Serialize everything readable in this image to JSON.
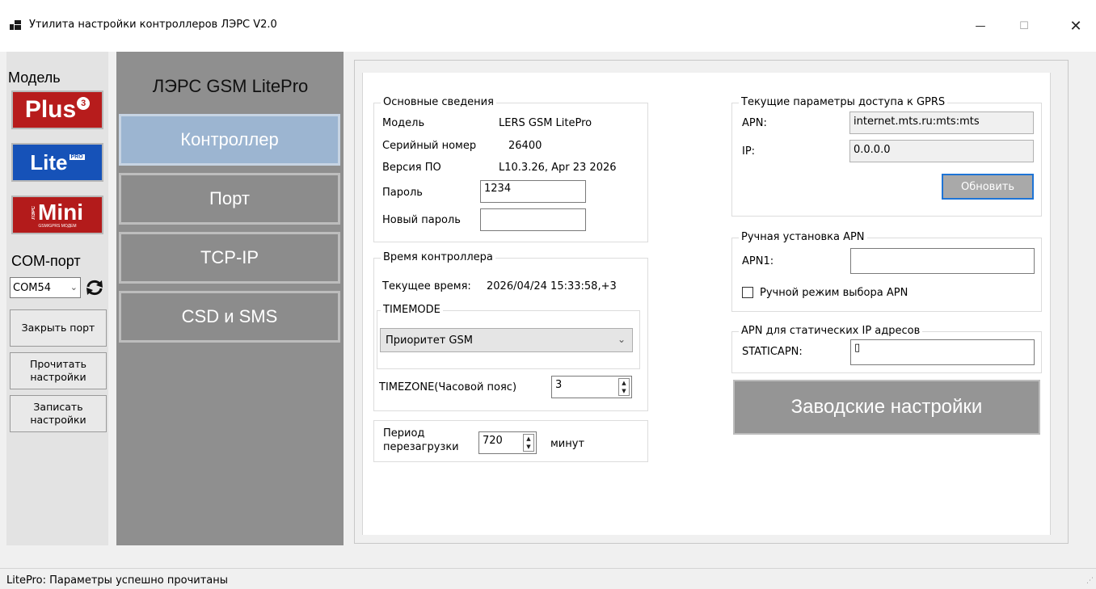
{
  "window": {
    "title": "Утилита настройки контроллеров ЛЭРС V2.0",
    "minimize": "—",
    "maximize": "☐",
    "close": "✕"
  },
  "left": {
    "model_label": "Модель",
    "logos": {
      "plus": "Plus",
      "plus_badge": "3",
      "lite": "Lite",
      "lite_badge": "PRO",
      "mini": "Mini",
      "mini_side": "ЛЭРС",
      "mini_caption": "GSM/GPRS МОДЕМ"
    },
    "com_label": "COM-порт",
    "com_value": "COM54",
    "buttons": {
      "close_port": "Закрыть порт",
      "read_settings": "Прочитать настройки",
      "write_settings": "Записать настройки"
    }
  },
  "nav": {
    "title": "ЛЭРС GSM LitePro",
    "items": [
      "Контроллер",
      "Порт",
      "TCP-IP",
      "CSD и SMS"
    ],
    "active_index": 0
  },
  "basic": {
    "title": "Основные сведения",
    "model_label": "Модель",
    "model_value": "LERS GSM LitePro",
    "serial_label": "Серийный номер",
    "serial_value": "26400",
    "fw_label": "Версия ПО",
    "fw_value": "L10.3.26, Apr 23 2026",
    "password_label": "Пароль",
    "password_value": "1234",
    "new_password_label": "Новый пароль",
    "new_password_value": ""
  },
  "time": {
    "title": "Время контроллера",
    "current_label": "Текущее время:",
    "current_value": "2026/04/24 15:33:58,+3",
    "timemode_title": "TIMEMODE",
    "timemode_value": "Приоритет GSM",
    "timezone_label": "TIMEZONE(Часовой пояс)",
    "timezone_value": "3"
  },
  "reboot": {
    "label": "Период перезагрузки",
    "value": "720",
    "unit": "минут"
  },
  "gprs": {
    "title": "Текущие параметры доступа к GPRS",
    "apn_label": "APN:",
    "apn_value": "internet.mts.ru:mts:mts",
    "ip_label": "IP:",
    "ip_value": "0.0.0.0",
    "update_button": "Обновить"
  },
  "manual_apn": {
    "title": "Ручная установка APN",
    "apn1_label": "APN1:",
    "apn1_value": "",
    "checkbox_label": "Ручной режим выбора APN"
  },
  "static_apn": {
    "title": "APN для статических IP адресов",
    "label": "STATICAPN:",
    "value": "▯"
  },
  "factory_button": "Заводские настройки",
  "status": "LitePro: Параметры успешно прочитаны"
}
